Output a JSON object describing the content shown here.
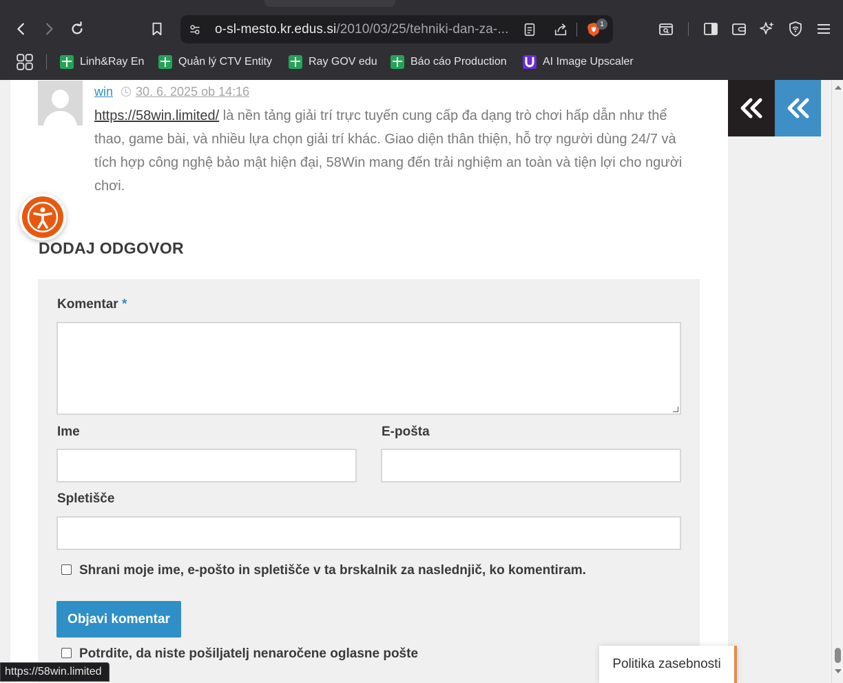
{
  "browser": {
    "url_host": "o-sl-mesto.kr.edus.si",
    "url_path": "/2010/03/25/tehniki-dan-za-...",
    "brave_badge": "1",
    "bookmarks": [
      {
        "label": "Linh&Ray En"
      },
      {
        "label": "Quản lý CTV Entity"
      },
      {
        "label": "Ray GOV edu"
      },
      {
        "label": "Báo cáo Production"
      },
      {
        "label": "AI Image Upscaler"
      }
    ],
    "status_url": "https://58win.limited"
  },
  "comment": {
    "author": "win",
    "date": "30. 6. 2025 ob 14:16",
    "link_text": "https://58win.limited/",
    "body": " là nền tảng giải trí trực tuyến cung cấp đa dạng trò chơi hấp dẫn như thể thao, game bài, và nhiều lựa chọn giải trí khác. Giao diện thân thiện, hỗ trợ người dùng 24/7 và tích hợp công nghệ bảo mật hiện đại, 58Win mang đến trải nghiệm an toàn và tiện lợi cho người chơi."
  },
  "reply": {
    "title": "DODAJ ODGOVOR",
    "comment_label": "Komentar",
    "required_mark": "*",
    "name_label": "Ime",
    "email_label": "E-pošta",
    "website_label": "Spletišče",
    "save_consent": "Shrani moje ime, e-pošto in spletišče v ta brskalnik za naslednjič, ko komentiram.",
    "submit_label": "Objavi komentar",
    "spam_confirm": "Potrdite, da niste pošiljatelj nenaročene oglasne pošte"
  },
  "privacy_button": "Politika zasebnosti",
  "colors": {
    "accent": "#2f8fc7",
    "accessibility": "#e8590f",
    "sidebar_dark": "#231f20",
    "sidebar_blue": "#3d8fc6"
  }
}
